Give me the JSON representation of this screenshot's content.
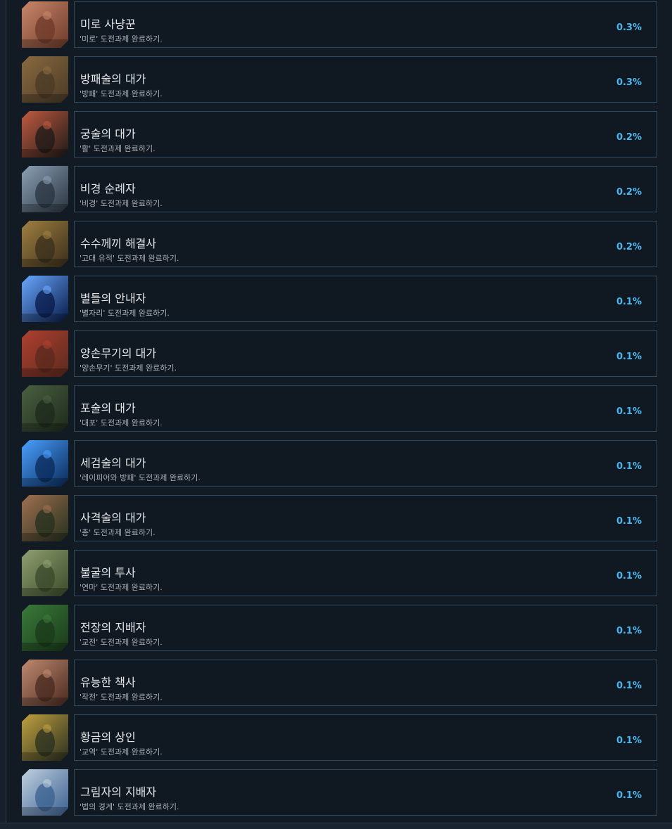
{
  "achievements": [
    {
      "title": "미로 사냥꾼",
      "desc": "'미로' 도전과제 완료하기.",
      "pct": "0.3%",
      "icon": "maze-ruins-icon",
      "icon_colors": [
        "#6e3a2a",
        "#c9876a"
      ]
    },
    {
      "title": "방패술의 대가",
      "desc": "'방패' 도전과제 완료하기.",
      "pct": "0.3%",
      "icon": "shield-warrior-icon",
      "icon_colors": [
        "#4a3a26",
        "#8a6a40"
      ]
    },
    {
      "title": "궁술의 대가",
      "desc": "'활' 도전과제 완료하기.",
      "pct": "0.2%",
      "icon": "archer-icon",
      "icon_colors": [
        "#1e1a18",
        "#c05a40"
      ]
    },
    {
      "title": "비경 순례자",
      "desc": "'비경' 도전과제 완료하기.",
      "pct": "0.2%",
      "icon": "waterfall-icon",
      "icon_colors": [
        "#2a3440",
        "#8aa0b4"
      ]
    },
    {
      "title": "수수께끼 해결사",
      "desc": "'고대 유적' 도전과제 완료하기.",
      "pct": "0.2%",
      "icon": "ancient-dial-icon",
      "icon_colors": [
        "#3a2e1c",
        "#a08040"
      ]
    },
    {
      "title": "별들의 안내자",
      "desc": "'별자리' 도전과제 완료하기.",
      "pct": "0.1%",
      "icon": "constellation-icon",
      "icon_colors": [
        "#081a48",
        "#6aa8ff"
      ]
    },
    {
      "title": "양손무기의 대가",
      "desc": "'양손무기' 도전과제 완료하기.",
      "pct": "0.1%",
      "icon": "two-handed-weapon-icon",
      "icon_colors": [
        "#5a2a1e",
        "#b04030"
      ]
    },
    {
      "title": "포술의 대가",
      "desc": "'대포' 도전과제 완료하기.",
      "pct": "0.1%",
      "icon": "cannon-icon",
      "icon_colors": [
        "#1e2a1c",
        "#4a6040"
      ]
    },
    {
      "title": "세검술의 대가",
      "desc": "'레이피어와 방패' 도전과제 완료하기.",
      "pct": "0.1%",
      "icon": "rapier-icon",
      "icon_colors": [
        "#0a2a5a",
        "#4aa0ff"
      ]
    },
    {
      "title": "사격술의 대가",
      "desc": "'총' 도전과제 완료하기.",
      "pct": "0.1%",
      "icon": "gunner-icon",
      "icon_colors": [
        "#24301e",
        "#a07050"
      ]
    },
    {
      "title": "불굴의 투사",
      "desc": "'연마' 도전과제 완료하기.",
      "pct": "0.1%",
      "icon": "forest-warrior-icon",
      "icon_colors": [
        "#3a4a2a",
        "#90a070"
      ]
    },
    {
      "title": "전장의 지배자",
      "desc": "'교전' 도전과제 완료하기.",
      "pct": "0.1%",
      "icon": "battlefield-icon",
      "icon_colors": [
        "#1a3a1a",
        "#3a7a3a"
      ]
    },
    {
      "title": "유능한 책사",
      "desc": "'작전' 도전과제 완료하기.",
      "pct": "0.1%",
      "icon": "temple-gate-icon",
      "icon_colors": [
        "#4a2a20",
        "#c08a70"
      ]
    },
    {
      "title": "황금의 상인",
      "desc": "'교역' 도전과제 완료하기.",
      "pct": "0.1%",
      "icon": "merchant-stall-icon",
      "icon_colors": [
        "#2a3020",
        "#c0a040"
      ]
    },
    {
      "title": "그림자의 지배자",
      "desc": "'법의 경계' 도전과제 완료하기.",
      "pct": "0.1%",
      "icon": "sky-city-icon",
      "icon_colors": [
        "#3a6090",
        "#c0d0e0"
      ]
    }
  ]
}
